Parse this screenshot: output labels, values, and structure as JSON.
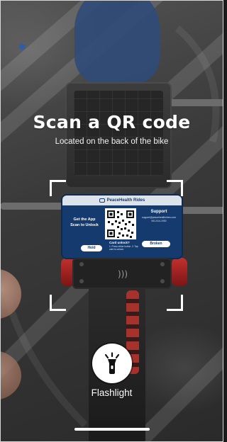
{
  "header": {
    "title": "Scan a QR code",
    "subtitle": "Located on the back of the bike"
  },
  "lock_panel": {
    "brand": "PeaceHealth Rides",
    "left_line1": "Get the App",
    "left_line2": "Scan to Unlock",
    "right_title": "Support",
    "right_small": "support@peacehealthrides.com 541-514-1930",
    "hold_label": "Hold",
    "broken_label": "Broken",
    "card_title": "Card unlock?",
    "card_small": "1. Press either button. 2. Tap card to unlock."
  },
  "flashlight": {
    "label": "Flashlight",
    "icon": "flashlight-icon"
  },
  "colors": {
    "panel_blue": "#143a6e",
    "tail_red": "#c2302c",
    "accent_blue": "#2e5ca8"
  }
}
